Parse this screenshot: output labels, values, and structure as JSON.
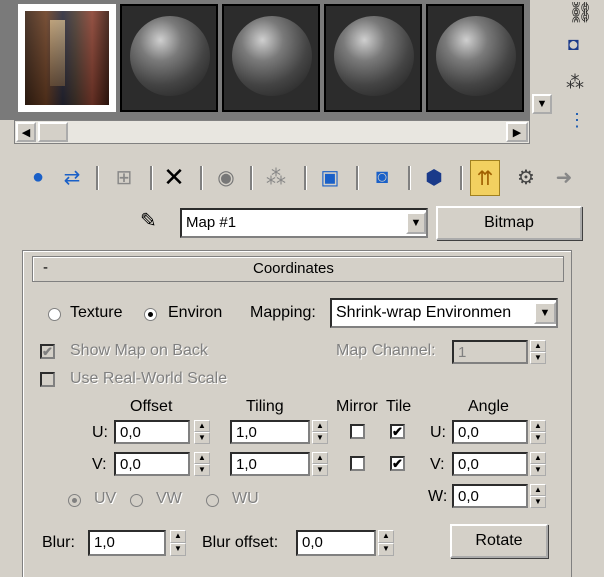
{
  "material_editor": {
    "slot_names": [
      "bitmap-preview",
      "sphere",
      "sphere",
      "sphere",
      "sphere"
    ],
    "toolbar_icons": [
      "get-material-icon",
      "put-to-scene-icon",
      "assign-material-icon",
      "reset-map-icon",
      "make-unique-icon",
      "put-to-library-icon",
      "material-id-icon",
      "show-map-icon",
      "show-end-result-icon",
      "go-to-parent-icon",
      "go-forward-icon"
    ],
    "map_name": "Map #1",
    "map_type_button": "Bitmap",
    "rollout_toggle": "-",
    "rollout_title": "Coordinates",
    "texture_label": "Texture",
    "environ_label": "Environ",
    "mapping_label": "Mapping:",
    "mapping_value": "Shrink-wrap Environmen",
    "show_map_on_back": "Show Map on Back",
    "map_channel_label": "Map Channel:",
    "map_channel_value": "1",
    "use_real_world_scale": "Use Real-World Scale",
    "headers": {
      "offset": "Offset",
      "tiling": "Tiling",
      "mirror": "Mirror",
      "tile": "Tile",
      "angle": "Angle"
    },
    "u_label": "U:",
    "v_label": "V:",
    "w_label": "W:",
    "offset_u": "0,0",
    "offset_v": "0,0",
    "tiling_u": "1,0",
    "tiling_v": "1,0",
    "angle_u": "0,0",
    "angle_v": "0,0",
    "angle_w": "0,0",
    "uv_label": "UV",
    "vw_label": "VW",
    "wu_label": "WU",
    "blur_label": "Blur:",
    "blur_value": "1,0",
    "blur_offset_label": "Blur offset:",
    "blur_offset_value": "0,0",
    "rotate_button": "Rotate",
    "check_mark": "✔"
  }
}
